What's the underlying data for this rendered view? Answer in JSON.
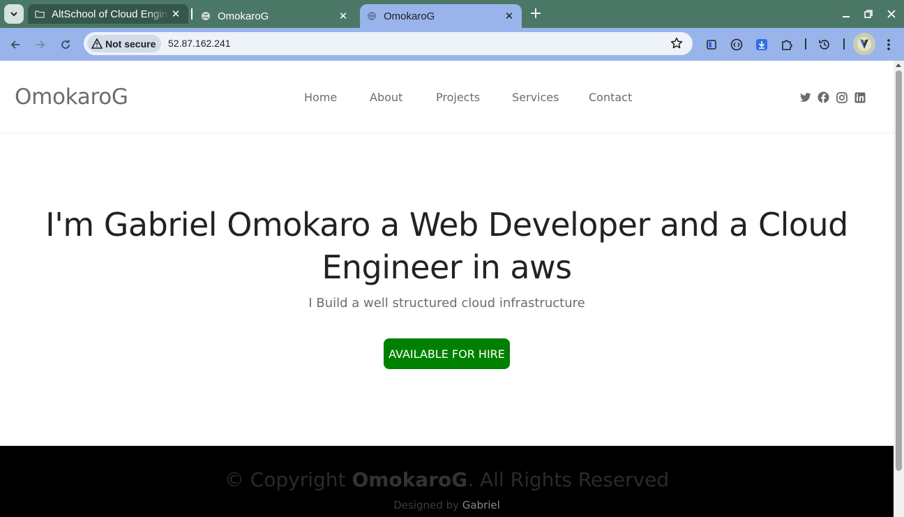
{
  "browser": {
    "tabs": [
      {
        "title": "AltSchool of Cloud Engin",
        "active": false
      },
      {
        "title": "OmokaroG",
        "active": false
      },
      {
        "title": "OmokaroG",
        "active": true
      }
    ],
    "security_label": "Not secure",
    "url": "52.87.162.241",
    "colors": {
      "tabstrip": "#4b7766",
      "toolbar": "#99b4ea",
      "active_tab": "#99b4ea"
    }
  },
  "site": {
    "logo": "OmokaroG",
    "nav": [
      "Home",
      "About",
      "Projects",
      "Services",
      "Contact"
    ],
    "socials": [
      "twitter-icon",
      "facebook-icon",
      "instagram-icon",
      "linkedin-icon"
    ]
  },
  "hero": {
    "title_line1": "I'm Gabriel Omokaro a Web Developer and a Cloud",
    "title_line2": "Engineer in aws",
    "subtitle": "I Build a well structured cloud infrastructure",
    "cta": "AVAILABLE FOR HIRE",
    "cta_color": "#008000"
  },
  "footer": {
    "copyright_prefix": "© Copyright ",
    "brand": "OmokaroG",
    "copyright_suffix": ". All Rights Reserved",
    "designed_by_label": "Designed by ",
    "designer": "Gabriel"
  }
}
